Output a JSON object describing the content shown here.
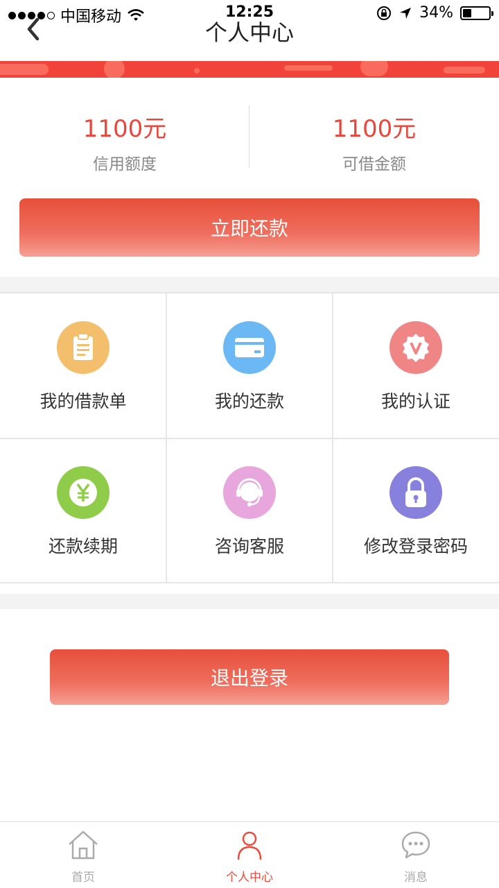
{
  "status_bar": {
    "carrier": "中国移动",
    "time": "12:25",
    "battery": "34%",
    "battery_level": 0.34
  },
  "header": {
    "title": "个人中心"
  },
  "amounts": [
    {
      "value": "1100元",
      "label": "信用额度"
    },
    {
      "value": "1100元",
      "label": "可借金额"
    }
  ],
  "actions": {
    "repay_now": "立即还款",
    "logout": "退出登录"
  },
  "menu": [
    {
      "label": "我的借款单",
      "icon": "clipboard-icon",
      "color": "#f3bf6c"
    },
    {
      "label": "我的还款",
      "icon": "card-icon",
      "color": "#6cb8f4"
    },
    {
      "label": "我的认证",
      "icon": "verified-badge-icon",
      "color": "#ef8585"
    },
    {
      "label": "还款续期",
      "icon": "yen-icon",
      "color": "#8fcc4a"
    },
    {
      "label": "咨询客服",
      "icon": "headset-icon",
      "color": "#e8a7dc"
    },
    {
      "label": "修改登录密码",
      "icon": "lock-icon",
      "color": "#8780dc"
    }
  ],
  "tabbar": [
    {
      "label": "首页",
      "icon": "home-icon",
      "active": false
    },
    {
      "label": "个人中心",
      "icon": "person-icon",
      "active": true
    },
    {
      "label": "消息",
      "icon": "chat-icon",
      "active": false
    }
  ],
  "colors": {
    "accent": "#e8473c",
    "banner": "#f2433a"
  }
}
